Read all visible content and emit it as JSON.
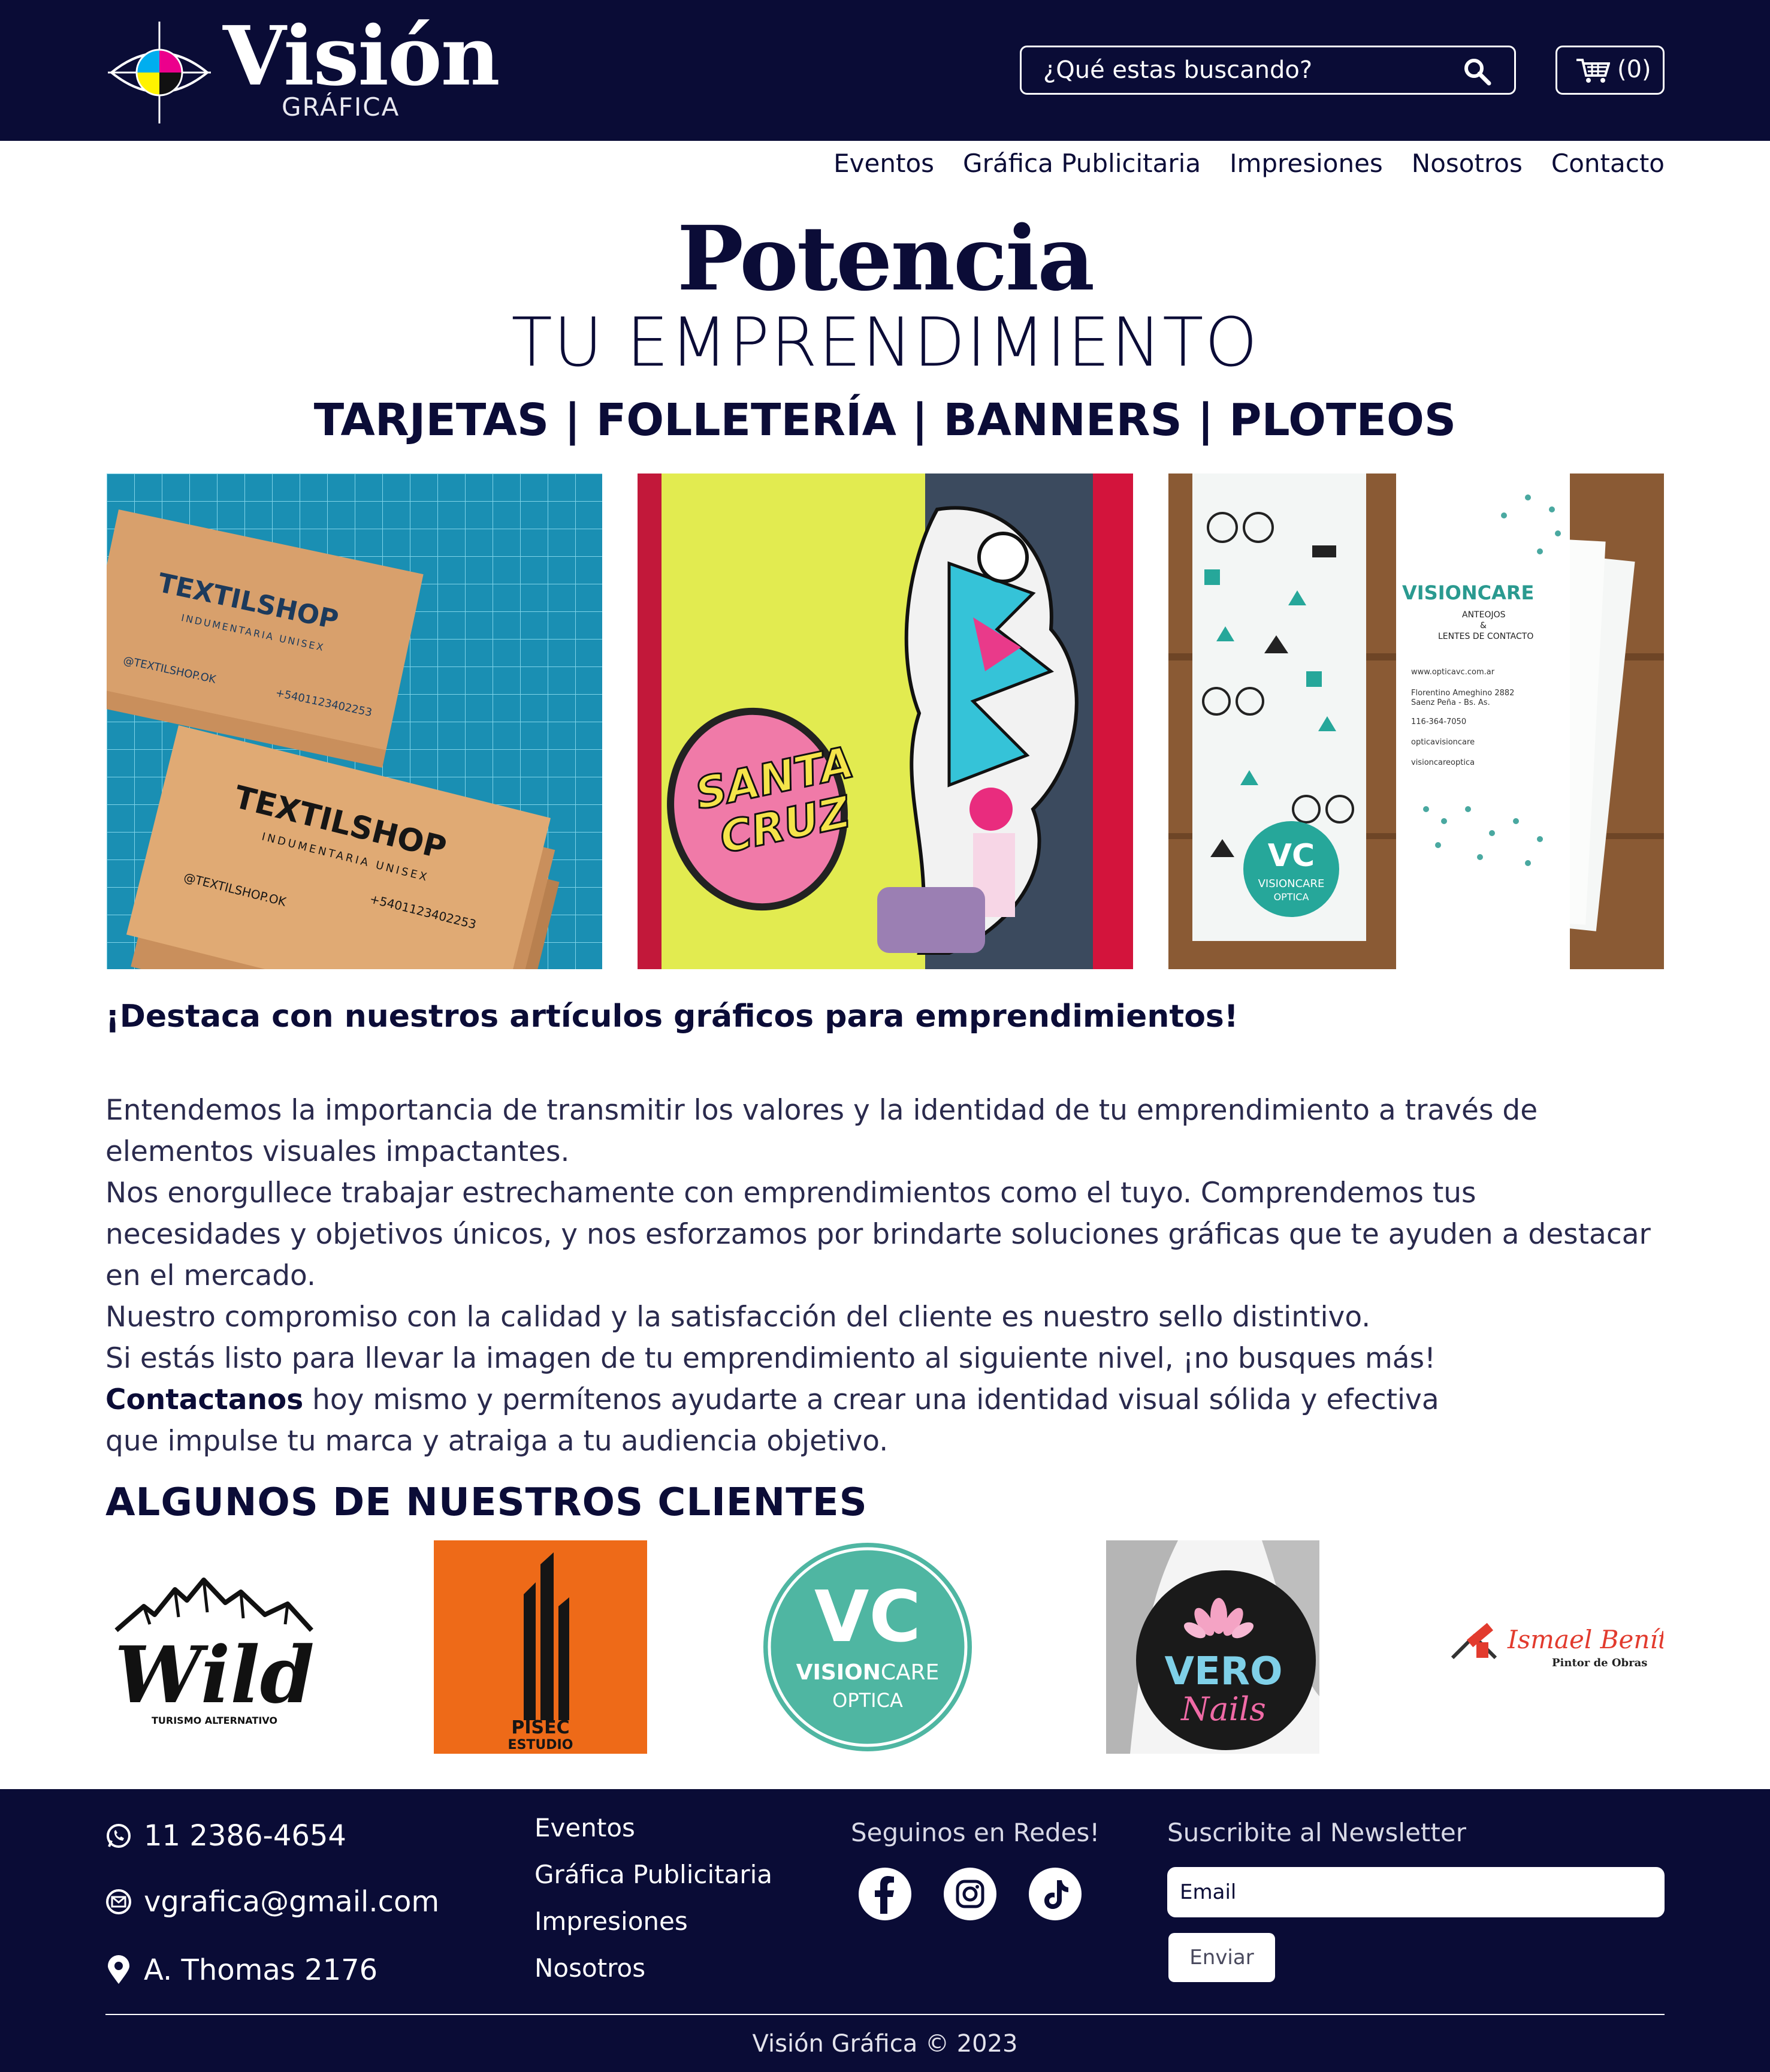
{
  "brand": {
    "name": "Visión",
    "subname": "GRÁFICA",
    "colors": {
      "navy": "#0a0c36",
      "cyan": "#00aeef",
      "magenta": "#ec008c",
      "yellow": "#fff200",
      "teal": "#4fb6a2"
    }
  },
  "header": {
    "search": {
      "placeholder": "¿Qué estas buscando?",
      "icon": "search-icon"
    },
    "cart": {
      "icon": "cart-icon",
      "count_label": "(0)"
    }
  },
  "nav": {
    "items": [
      "Eventos",
      "Gráfica Publicitaria",
      "Impresiones",
      "Nosotros",
      "Contacto"
    ]
  },
  "hero": {
    "title": "Potencia",
    "subtitle": "TU EMPRENDIMIENTO",
    "tags": "TARJETAS | FOLLETERÍA | BANNERS | PLOTEOS"
  },
  "photos": [
    {
      "name": "textilshop-cards",
      "brand": "TEXTILSHOP",
      "tagline": "INDUMENTARIA UNISEX",
      "handle": "@TEXTILSHOP.OK",
      "phone": "+5401123402253"
    },
    {
      "name": "santa-cruz-window",
      "brand_line1": "SANTA",
      "brand_line2": "CRUZ"
    },
    {
      "name": "visioncare-flyers",
      "brand": "VISIONCARE",
      "line1": "ANTEOJOS",
      "line2": "&",
      "line3": "LENTES DE CONTACTO",
      "web": "www.opticavc.com.ar",
      "address1": "Florentino Ameghino 2882",
      "address2": "Saenz Peña - Bs. As.",
      "phone": "116-364-7050",
      "fb": "opticavisioncare",
      "ig": "visioncareoptica",
      "badge_initials": "VC",
      "badge_name": "VISIONCARE",
      "badge_sub": "OPTICA"
    }
  ],
  "content": {
    "lead": "¡Destaca con nuestros artículos gráficos para emprendimientos!",
    "p1a": "Entendemos la importancia de transmitir los valores y la identidad de tu emprendimiento a través de",
    "p1b": "elementos visuales impactantes.",
    "p2a": "Nos enorgullece trabajar estrechamente con emprendimientos como el tuyo. Comprendemos tus",
    "p2b": "necesidades y objetivos únicos, y nos esforzamos por brindarte soluciones gráficas que te ayuden a destacar",
    "p2c": "en el mercado.",
    "p3": "Nuestro compromiso con la calidad y la satisfacción del cliente es nuestro sello distintivo.",
    "p4": "Si estás listo para llevar la imagen de tu emprendimiento al siguiente nivel, ¡no busques más!",
    "contact_link": "Contactanos",
    "p5a": " hoy mismo y permítenos ayudarte a crear una identidad visual sólida y efectiva",
    "p5b": "que impulse tu marca y atraiga a tu audiencia objetivo."
  },
  "clients": {
    "title": "ALGUNOS DE NUESTROS CLIENTES",
    "wild": {
      "name": "Wild",
      "tag": "TURISMO ALTERNATIVO"
    },
    "pisec": {
      "line1": "PISEC",
      "line2": "ESTUDIO"
    },
    "visioncare": {
      "initials": "VC",
      "name_bold": "VISION",
      "name_light": "CARE",
      "sub": "OPTICA"
    },
    "vero": {
      "name": "VERO",
      "sub": "Nails"
    },
    "ismael": {
      "name": "Ismael Benítez",
      "sub": "Pintor de Obras"
    }
  },
  "footer": {
    "phone": "11 2386-4654",
    "email": "vgrafica@gmail.com",
    "address": "A. Thomas 2176",
    "links": [
      "Eventos",
      "Gráfica Publicitaria",
      "Impresiones",
      "Nosotros"
    ],
    "social_title": "Seguinos en Redes!",
    "social_icons": [
      "facebook-icon",
      "instagram-icon",
      "tiktok-icon"
    ],
    "newsletter_title": "Suscribite al Newsletter",
    "newsletter_placeholder": "Email",
    "send_label": "Enviar",
    "copyright": "Visión Gráfica © 2023"
  }
}
